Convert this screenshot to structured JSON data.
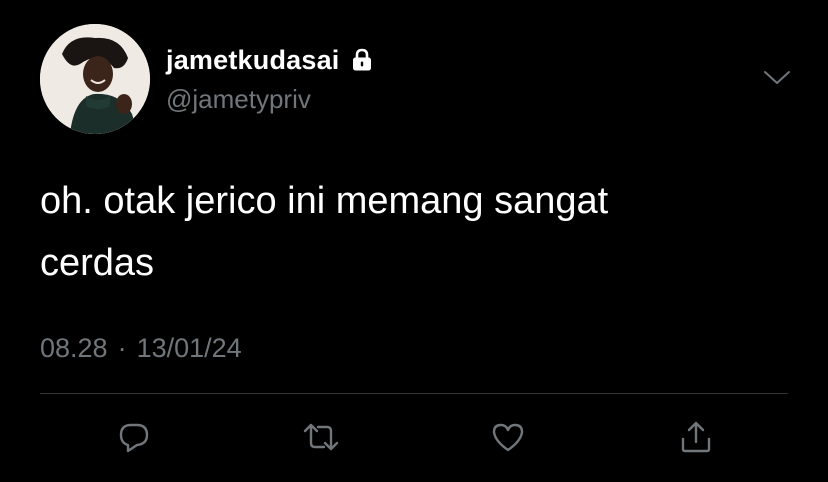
{
  "tweet": {
    "author": {
      "display_name": "jametkudasai",
      "handle": "@jametypriv",
      "protected_icon": "lock-icon",
      "avatar": "profile-photo"
    },
    "text_lines": [
      "oh. otak jerico ini memang sangat",
      "cerdas"
    ],
    "time": "08.28",
    "separator": "·",
    "date": "13/01/24",
    "menu_icon": "chevron-down-icon"
  },
  "actions": [
    {
      "icon": "reply-icon"
    },
    {
      "icon": "retweet-icon"
    },
    {
      "icon": "like-icon"
    },
    {
      "icon": "share-icon"
    }
  ],
  "colors": {
    "background": "#000000",
    "primary_text": "#ffffff",
    "secondary_text": "#71767b",
    "divider": "#2f3336"
  }
}
